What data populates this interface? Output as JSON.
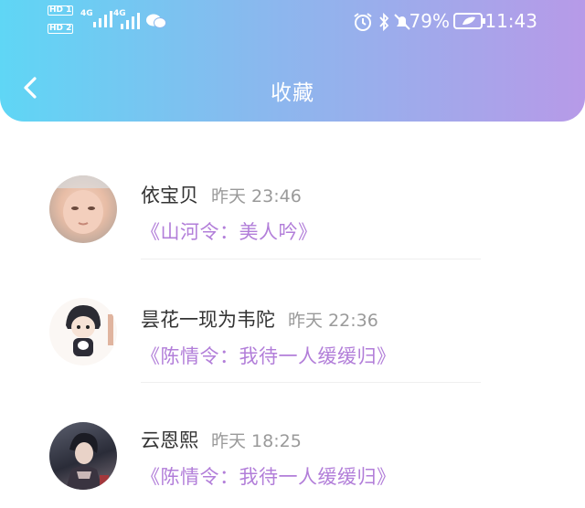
{
  "status_bar": {
    "sim1": "HD 1",
    "sim2": "HD 2",
    "net1": "4G",
    "net2": "4G",
    "battery_percent": "79%",
    "time": "11:43",
    "icons": [
      "alarm-icon",
      "bluetooth-icon",
      "mute-bell-icon",
      "battery-icon",
      "wechat-icon",
      "signal-icon"
    ]
  },
  "nav": {
    "title": "收藏",
    "back_icon": "chevron-left-icon"
  },
  "favorites": [
    {
      "user": "依宝贝",
      "time": "昨天 23:46",
      "work": "《山河令：美人吟》",
      "avatar": "baby-photo"
    },
    {
      "user": "昙花一现为韦陀",
      "time": "昨天 22:36",
      "work": "《陈情令：我待一人缓缓归》",
      "avatar": "chibi-drawing"
    },
    {
      "user": "云恩熙",
      "time": "昨天 18:25",
      "work": "《陈情令：我待一人缓缓归》",
      "avatar": "anime-figure"
    }
  ],
  "colors": {
    "header_gradient_start": "#5fd6f5",
    "header_gradient_end": "#b79ae8",
    "work_title": "#b27ed9",
    "timestamp": "#9a9a9a"
  }
}
